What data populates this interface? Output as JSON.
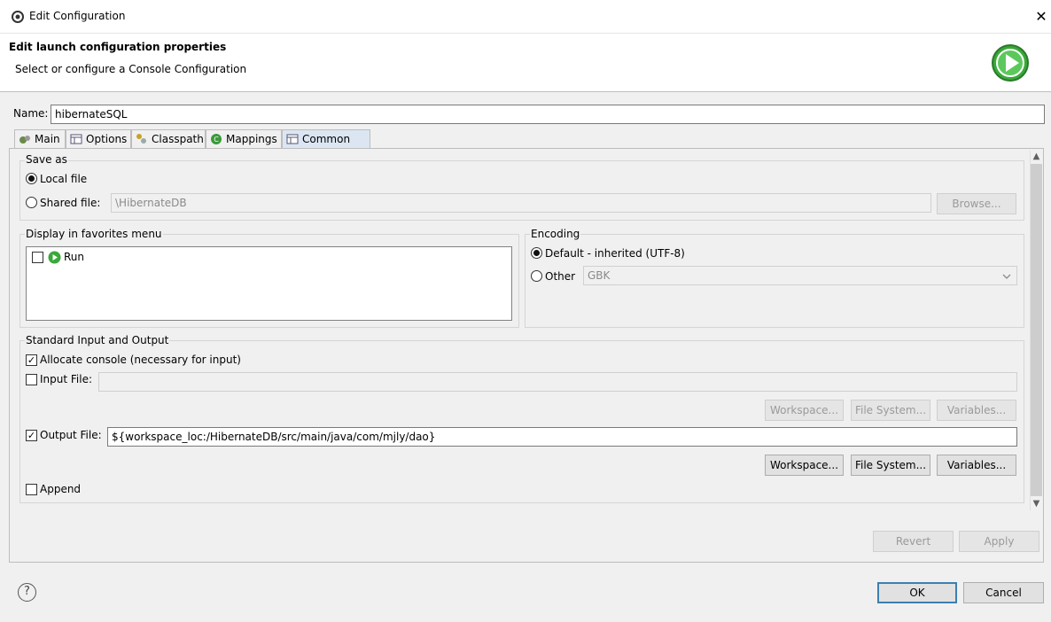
{
  "window": {
    "title": "Edit Configuration",
    "close_glyph": "✕"
  },
  "header": {
    "title": "Edit launch configuration properties",
    "subtitle": "Select or configure a Console Configuration",
    "badge_icon": "run-icon"
  },
  "config": {
    "name_label": "Name:",
    "name_value": "hibernateSQL"
  },
  "tabs": [
    {
      "label": "Main",
      "icon": "main-icon"
    },
    {
      "label": "Options",
      "icon": "options-icon"
    },
    {
      "label": "Classpath",
      "icon": "classpath-icon"
    },
    {
      "label": "Mappings",
      "icon": "mappings-icon"
    },
    {
      "label": "Common",
      "icon": "common-icon",
      "active": true
    }
  ],
  "save_as": {
    "label": "Save as",
    "local_file": "Local file",
    "shared_file": "Shared file:",
    "shared_path": "\\HibernateDB",
    "browse": "Browse...",
    "selected": "local"
  },
  "favorites": {
    "label": "Display in favorites menu",
    "items": [
      {
        "label": "Run",
        "checked": false
      }
    ]
  },
  "encoding": {
    "label": "Encoding",
    "default_option": "Default - inherited (UTF-8)",
    "other_option": "Other",
    "other_value": "GBK",
    "selected": "default"
  },
  "std_io": {
    "label": "Standard Input and Output",
    "allocate_console": "Allocate console (necessary for input)",
    "allocate_checked": true,
    "input_file": "Input File:",
    "input_checked": false,
    "input_value": "",
    "output_file": "Output File:",
    "output_checked": true,
    "output_value": "${workspace_loc:/HibernateDB/src/main/java/com/mjly/dao}",
    "append": "Append",
    "append_checked": false,
    "workspace": "Workspace...",
    "file_system": "File System...",
    "variables": "Variables..."
  },
  "actions": {
    "revert": "Revert",
    "apply": "Apply",
    "ok": "OK",
    "cancel": "Cancel",
    "help_glyph": "?"
  },
  "colors": {
    "accent": "#3c7fb1",
    "run_green": "#3aa83a",
    "active_tab": "#dbe6f2"
  }
}
